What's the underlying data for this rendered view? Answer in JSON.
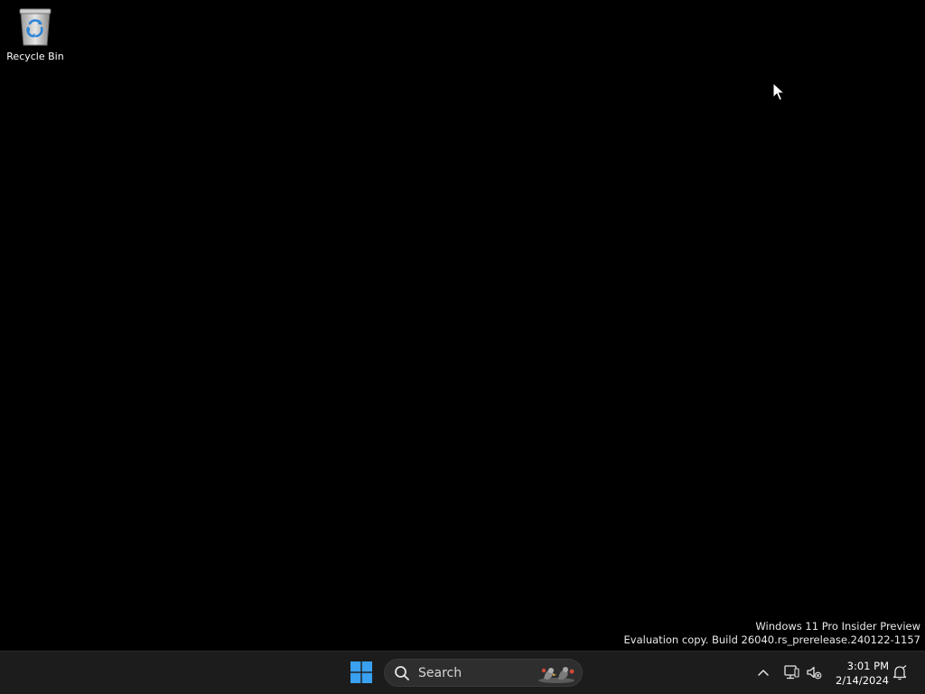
{
  "desktop": {
    "icons": [
      {
        "label": "Recycle Bin",
        "icon": "recycle-bin-icon"
      }
    ],
    "watermark": {
      "line1": "Windows 11 Pro Insider Preview",
      "line2": "Evaluation copy. Build 26040.rs_prerelease.240122-1157"
    }
  },
  "taskbar": {
    "start_icon": "windows-logo-icon",
    "search": {
      "label": "Search",
      "icon": "search-icon",
      "highlight_icon": "search-highlight-icon"
    },
    "tray": {
      "overflow_icon": "chevron-up-icon",
      "network_icon": "network-icon",
      "volume_icon": "volume-muted-icon",
      "notification_icon": "notification-bell-icon"
    },
    "clock": {
      "time": "3:01 PM",
      "date": "2/14/2024"
    }
  },
  "colors": {
    "desktop_bg": "#000000",
    "taskbar_bg": "#1c1c1c",
    "start_blue": "#3aa0f0"
  }
}
